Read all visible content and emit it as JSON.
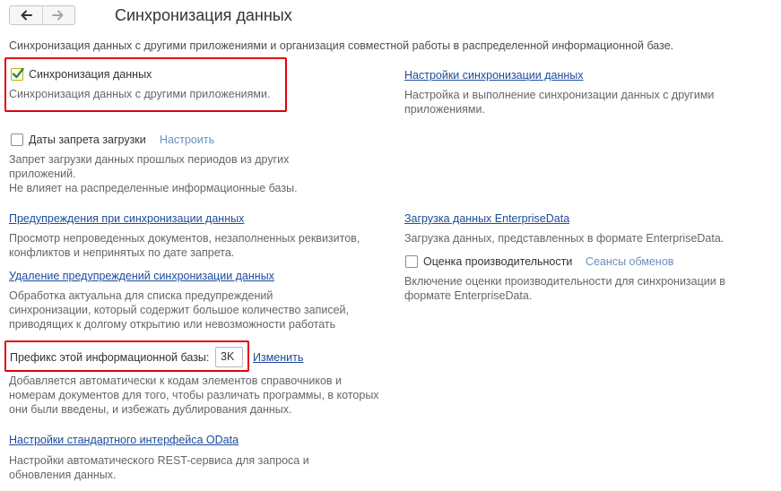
{
  "header": {
    "back_icon": "arrow-left-icon",
    "forward_icon": "arrow-right-icon",
    "title": "Синхронизация данных",
    "subtitle": "Синхронизация данных с другими приложениями и организация совместной работы в распределенной информационной базе."
  },
  "left": {
    "sync": {
      "checked": true,
      "label": "Синхронизация данных",
      "desc": "Синхронизация данных с другими приложениями."
    },
    "load_ban": {
      "checked": false,
      "label": "Даты запрета загрузки",
      "configure": "Настроить",
      "desc_1": "Запрет загрузки данных прошлых периодов из других",
      "desc_2": "приложений.",
      "desc_3": "Не влияет на распределенные информационные базы."
    },
    "warnings": {
      "link": "Предупреждения при синхронизации данных",
      "desc_1": "Просмотр непроведенных документов, незаполненных реквизитов,",
      "desc_2": "конфликтов и непринятых по дате запрета."
    },
    "delete_warnings": {
      "link": "Удаление предупреждений синхронизации данных",
      "desc_1": "Обработка актуальна для списка предупреждений",
      "desc_2": "синхронизации, который содержит большое количество записей,",
      "desc_3": "приводящих к долгому открытию или невозможности работать"
    },
    "prefix": {
      "label": "Префикс этой информационной базы:",
      "value": "3K",
      "change": "Изменить",
      "desc_1": "Добавляется автоматически к кодам элементов справочников и",
      "desc_2": "номерам документов для того, чтобы различать программы, в которых",
      "desc_3": "они были введены, и избежать дублирования данных."
    },
    "odata": {
      "link": "Настройки стандартного интерфейса OData",
      "desc_1": "Настройки автоматического REST-сервиса для запроса и",
      "desc_2": "обновления данных."
    }
  },
  "right": {
    "sync_settings": {
      "link": "Настройки синхронизации данных",
      "desc_1": "Настройка и выполнение синхронизации данных с другими",
      "desc_2": "приложениями."
    },
    "enterprise_data": {
      "link": "Загрузка данных EnterpriseData",
      "desc": "Загрузка данных, представленных в формате EnterpriseData."
    },
    "performance": {
      "checked": false,
      "label": "Оценка производительности",
      "sessions": "Сеансы обменов",
      "desc_1": "Включение оценки производительности для синхронизации в",
      "desc_2": "формате EnterpriseData."
    }
  },
  "colors": {
    "highlight": "#e1000f",
    "link": "#1c4a9c",
    "link_muted": "#6b90c0",
    "checkmark": "#2e8b2e"
  }
}
